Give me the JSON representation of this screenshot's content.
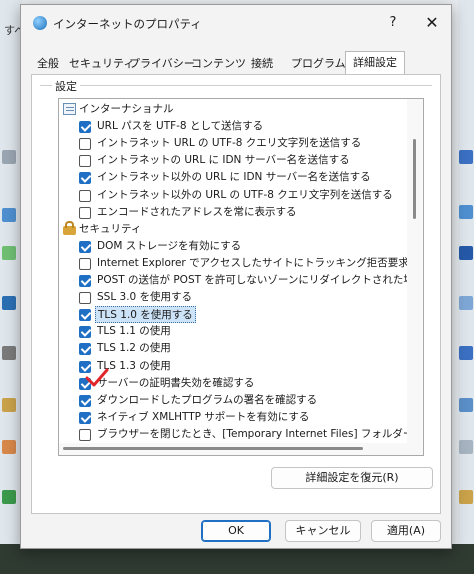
{
  "desktop": {
    "top_text": "すべ"
  },
  "dialog": {
    "title": "インターネットのプロパティ",
    "help_label": "?",
    "close_label": "✕"
  },
  "tabs": [
    {
      "label": "全般"
    },
    {
      "label": "セキュリティ"
    },
    {
      "label": "プライバシー"
    },
    {
      "label": "コンテンツ"
    },
    {
      "label": "接続"
    },
    {
      "label": "プログラム"
    },
    {
      "label": "詳細設定",
      "active": true
    }
  ],
  "settings": {
    "group_label": "設定",
    "items": [
      {
        "type": "category",
        "icon": "globe-folder-icon",
        "label": "インターナショナル"
      },
      {
        "type": "checkbox",
        "checked": true,
        "label": "URL パスを UTF-8 として送信する"
      },
      {
        "type": "checkbox",
        "checked": false,
        "label": "イントラネット URL の UTF-8 クエリ文字列を送信する"
      },
      {
        "type": "checkbox",
        "checked": false,
        "label": "イントラネットの URL に IDN サーバー名を送信する"
      },
      {
        "type": "checkbox",
        "checked": true,
        "label": "イントラネット以外の URL に IDN サーバー名を送信する"
      },
      {
        "type": "checkbox",
        "checked": false,
        "label": "イントラネット以外の URL の UTF-8 クエリ文字列を送信する"
      },
      {
        "type": "checkbox",
        "checked": false,
        "label": "エンコードされたアドレスを常に表示する"
      },
      {
        "type": "category",
        "icon": "lock-icon",
        "label": "セキュリティ"
      },
      {
        "type": "checkbox",
        "checked": true,
        "label": "DOM ストレージを有効にする"
      },
      {
        "type": "checkbox",
        "checked": false,
        "label": "Internet Explorer でアクセスしたサイトにトラッキング拒否要求を送信す"
      },
      {
        "type": "checkbox",
        "checked": true,
        "label": "POST の送信が POST を許可しないゾーンにリダイレクトされた場合に警告"
      },
      {
        "type": "checkbox",
        "checked": false,
        "label": "SSL 3.0 を使用する"
      },
      {
        "type": "checkbox",
        "checked": true,
        "label": "TLS 1.0 を使用する",
        "selected": true
      },
      {
        "type": "checkbox",
        "checked": true,
        "label": "TLS 1.1 の使用"
      },
      {
        "type": "checkbox",
        "checked": true,
        "label": "TLS 1.2 の使用"
      },
      {
        "type": "checkbox",
        "checked": true,
        "label": "TLS 1.3 の使用"
      },
      {
        "type": "checkbox",
        "checked": true,
        "label": "サーバーの証明書失効を確認する"
      },
      {
        "type": "checkbox",
        "checked": true,
        "label": "ダウンロードしたプログラムの署名を確認する"
      },
      {
        "type": "checkbox",
        "checked": true,
        "label": "ネイティブ XMLHTTP サポートを有効にする"
      },
      {
        "type": "checkbox",
        "checked": false,
        "label": "ブラウザーを閉じたとき、[Temporary Internet Files] フォルダーを空にす"
      }
    ],
    "restore_label": "詳細設定を復元(R)"
  },
  "footer": {
    "ok_label": "OK",
    "cancel_label": "キャンセル",
    "apply_label": "適用(A)"
  },
  "colors": {
    "accent": "#1f6fc4",
    "annotation_check": "#e0262b"
  }
}
